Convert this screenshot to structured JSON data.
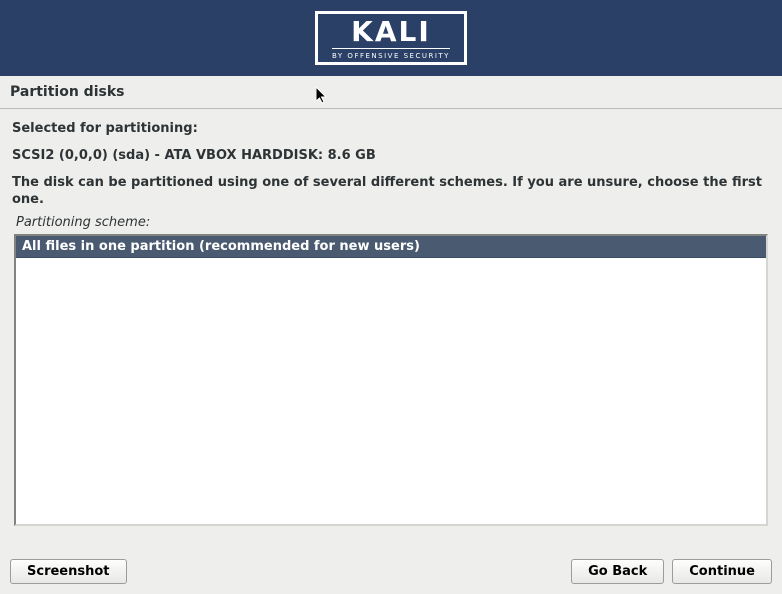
{
  "header": {
    "brand": "KALI",
    "tagline": "BY OFFENSIVE SECURITY"
  },
  "page_title": "Partition disks",
  "content": {
    "selected_label": "Selected for partitioning:",
    "disk_info": "SCSI2 (0,0,0) (sda) - ATA VBOX HARDDISK: 8.6 GB",
    "instruction": "The disk can be partitioned using one of several different schemes. If you are unsure, choose the first one.",
    "scheme_label": "Partitioning scheme:",
    "options": {
      "selected": "All files in one partition (recommended for new users)"
    }
  },
  "buttons": {
    "screenshot": "Screenshot",
    "go_back": "Go Back",
    "continue": "Continue"
  }
}
